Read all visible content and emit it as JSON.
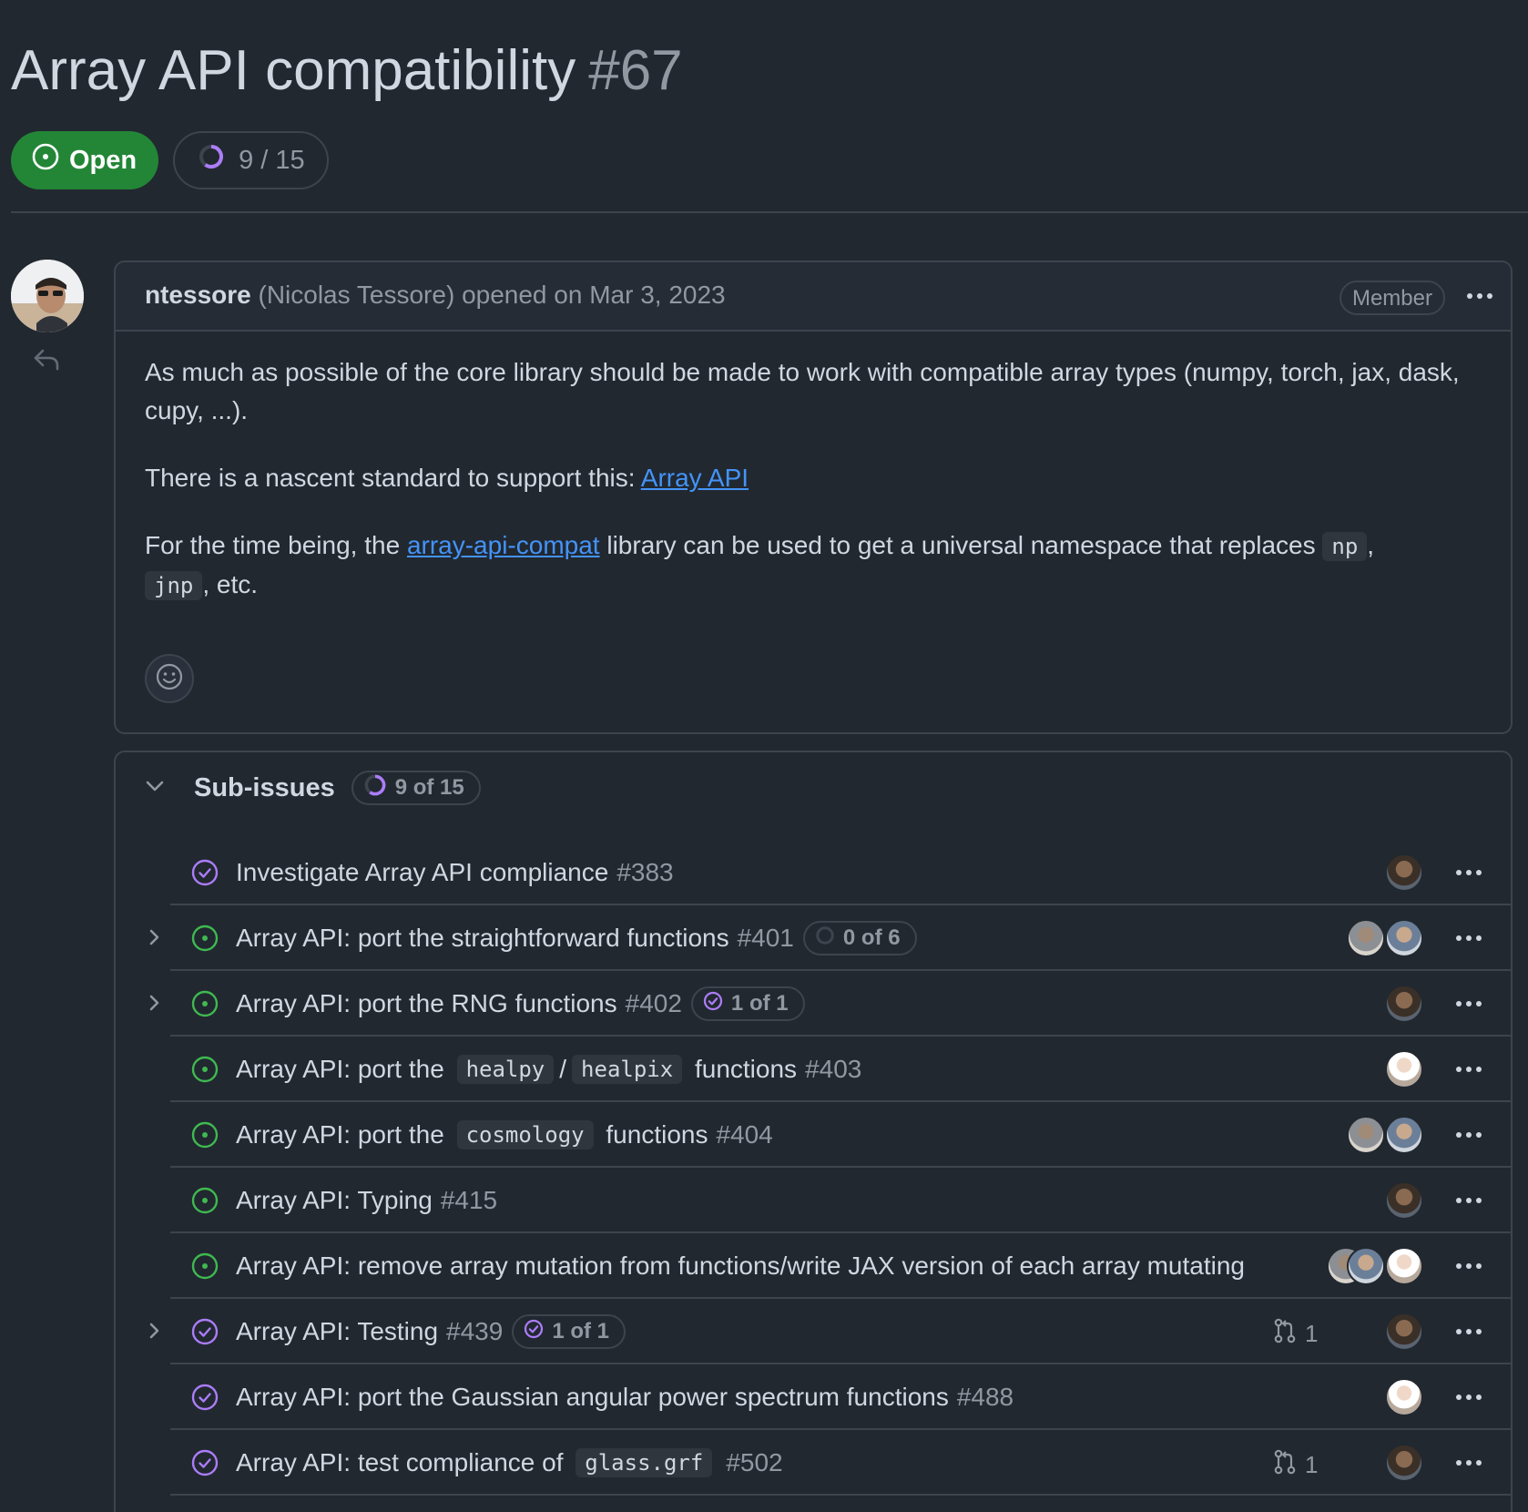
{
  "issue": {
    "title": "Array API compatibility",
    "number": "#67",
    "state_label": "Open",
    "progress_label": "9 / 15",
    "progress_fraction": 0.6
  },
  "comment": {
    "author": "ntessore",
    "author_fullname": "(Nicolas Tessore)",
    "action": "opened on Mar 3, 2023",
    "badge": "Member",
    "p1": "As much as possible of the core library should be made to work with compatible array types (numpy, torch, jax, dask, cupy, ...).",
    "p2_prefix": "There is a nascent standard to support this: ",
    "p2_link": "Array API",
    "p3_prefix": "For the time being, the ",
    "p3_link": "array-api-compat",
    "p3_mid": " library can be used to get a universal namespace that replaces ",
    "p3_code1": "np",
    "p3_sep": ",",
    "p3_code2": "jnp",
    "p3_suffix": ", etc."
  },
  "subissues": {
    "title": "Sub-issues",
    "count_label": "9 of 15",
    "colors": {
      "open": "#3fb950",
      "closed": "#ab7df8"
    },
    "items": [
      {
        "state": "closed",
        "expandable": false,
        "parts": [
          {
            "t": "text",
            "v": "Investigate Array API compliance"
          }
        ],
        "number": "#383",
        "avatars": [
          "a"
        ]
      },
      {
        "state": "open",
        "expandable": true,
        "parts": [
          {
            "t": "text",
            "v": "Array API: port the straightforward functions"
          }
        ],
        "number": "#401",
        "sub_count": "0 of 6",
        "sub_count_state": "empty",
        "avatars": [
          "c",
          "d"
        ]
      },
      {
        "state": "open",
        "expandable": true,
        "parts": [
          {
            "t": "text",
            "v": "Array API: port the RNG functions"
          }
        ],
        "number": "#402",
        "sub_count": "1 of 1",
        "sub_count_state": "done",
        "avatars": [
          "a"
        ]
      },
      {
        "state": "open",
        "expandable": false,
        "parts": [
          {
            "t": "text",
            "v": "Array API: port the "
          },
          {
            "t": "code",
            "v": "healpy"
          },
          {
            "t": "text",
            "v": "/"
          },
          {
            "t": "code",
            "v": "healpix"
          },
          {
            "t": "text",
            "v": " functions"
          }
        ],
        "number": "#403",
        "avatars": [
          "b"
        ]
      },
      {
        "state": "open",
        "expandable": false,
        "parts": [
          {
            "t": "text",
            "v": "Array API: port the "
          },
          {
            "t": "code",
            "v": "cosmology"
          },
          {
            "t": "text",
            "v": " functions"
          }
        ],
        "number": "#404",
        "avatars": [
          "c",
          "d"
        ]
      },
      {
        "state": "open",
        "expandable": false,
        "parts": [
          {
            "t": "text",
            "v": "Array API: Typing"
          }
        ],
        "number": "#415",
        "avatars": [
          "a"
        ]
      },
      {
        "state": "open",
        "expandable": false,
        "parts": [
          {
            "t": "text",
            "v": "Array API: remove array mutation from functions/write JAX version of each array mutating fun"
          }
        ],
        "number": "",
        "avatars": [
          "b",
          "c",
          "d"
        ]
      },
      {
        "state": "closed",
        "expandable": true,
        "parts": [
          {
            "t": "text",
            "v": "Array API: Testing"
          }
        ],
        "number": "#439",
        "sub_count": "1 of 1",
        "sub_count_state": "done",
        "pr_count": "1",
        "avatars": [
          "a"
        ]
      },
      {
        "state": "closed",
        "expandable": false,
        "parts": [
          {
            "t": "text",
            "v": "Array API: port the Gaussian angular power spectrum functions"
          }
        ],
        "number": "#488",
        "avatars": [
          "b"
        ]
      },
      {
        "state": "closed",
        "expandable": false,
        "parts": [
          {
            "t": "text",
            "v": "Array API: test compliance of "
          },
          {
            "t": "code",
            "v": "glass.grf"
          }
        ],
        "number": "#502",
        "pr_count": "1",
        "avatars": [
          "a"
        ]
      }
    ]
  }
}
